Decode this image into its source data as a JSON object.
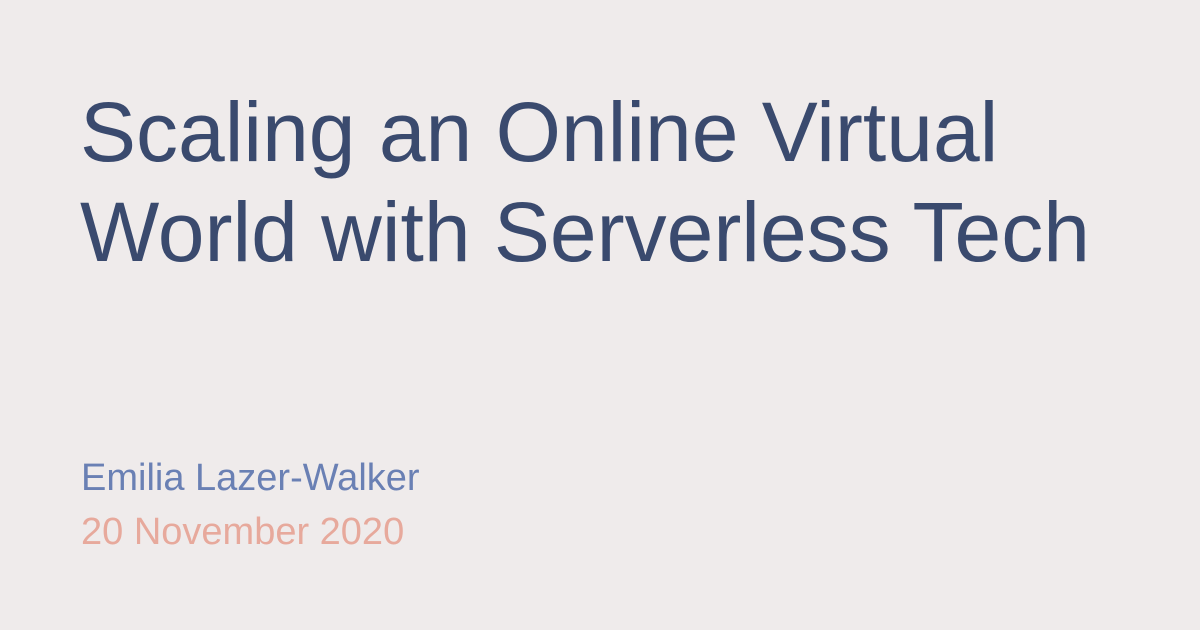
{
  "title": "Scaling an Online Virtual World with Serverless Tech",
  "author": "Emilia Lazer-Walker",
  "date": "20 November 2020",
  "colors": {
    "background": "#efebeb",
    "title": "#3a4a6e",
    "author": "#6a80b4",
    "date": "#e7a99c"
  }
}
